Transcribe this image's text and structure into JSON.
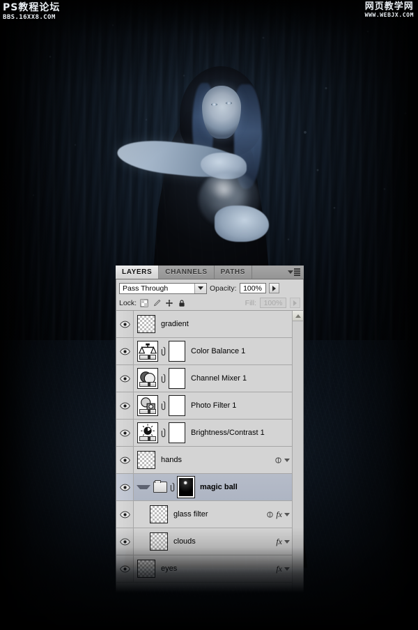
{
  "watermarks": {
    "top_left": {
      "title": "PS教程论坛",
      "url": "BBS.16XX8.COM"
    },
    "top_right": {
      "title": "网页教学网",
      "url": "WWW.WEBJX.COM"
    }
  },
  "artwork": {
    "description": "Dark forest scene with hooded woman holding a glowing smoky magic ball",
    "colors": {
      "background": "#05070b",
      "highlight": "#b9c9da",
      "hair": "#4a6a9a"
    }
  },
  "panel": {
    "title": "Layers panel",
    "tabs": [
      {
        "label": "LAYERS",
        "active": true
      },
      {
        "label": "CHANNELS",
        "active": false
      },
      {
        "label": "PATHS",
        "active": false
      }
    ],
    "menu_icon": "panel-menu-icon",
    "blend_mode": {
      "value": "Pass Through",
      "icon": "chevron-down-icon"
    },
    "opacity": {
      "label": "Opacity:",
      "value": "100%",
      "stepper_icon": "chevron-right-icon"
    },
    "lock": {
      "label": "Lock:",
      "icons": [
        "lock-transparent-pixels-icon",
        "lock-image-pixels-icon",
        "lock-position-icon",
        "lock-all-icon"
      ]
    },
    "fill": {
      "label": "Fill:",
      "value": "100%",
      "disabled": true,
      "stepper_icon": "chevron-right-icon"
    },
    "scrollbar": {
      "up_icon": "scroll-up-icon"
    },
    "layers": [
      {
        "name": "gradient",
        "visible": true,
        "selected": false,
        "indent": false,
        "thumb": "checker",
        "mask": null,
        "link": false,
        "fx": false,
        "style_dot": false,
        "expand": null,
        "folder": false
      },
      {
        "name": "Color Balance 1",
        "visible": true,
        "selected": false,
        "indent": false,
        "thumb": "adj-color-balance",
        "mask": "white",
        "link": true,
        "fx": false,
        "style_dot": false,
        "expand": null,
        "folder": false
      },
      {
        "name": "Channel Mixer 1",
        "visible": true,
        "selected": false,
        "indent": false,
        "thumb": "adj-channel-mixer",
        "mask": "white",
        "link": true,
        "fx": false,
        "style_dot": false,
        "expand": null,
        "folder": false
      },
      {
        "name": "Photo Filter 1",
        "visible": true,
        "selected": false,
        "indent": false,
        "thumb": "adj-photo-filter",
        "mask": "white",
        "link": true,
        "fx": false,
        "style_dot": false,
        "expand": null,
        "folder": false
      },
      {
        "name": "Brightness/Contrast 1",
        "visible": true,
        "selected": false,
        "indent": false,
        "thumb": "adj-brightness",
        "mask": "white",
        "link": true,
        "fx": false,
        "style_dot": false,
        "expand": null,
        "folder": false
      },
      {
        "name": "hands",
        "visible": true,
        "selected": false,
        "indent": false,
        "thumb": "checker",
        "mask": null,
        "link": false,
        "fx": false,
        "style_dot": true,
        "expand": null,
        "folder": false
      },
      {
        "name": "magic ball",
        "visible": true,
        "selected": true,
        "indent": false,
        "thumb": null,
        "mask": "black",
        "link": true,
        "fx": false,
        "style_dot": false,
        "expand": "open",
        "folder": true
      },
      {
        "name": "glass filter",
        "visible": true,
        "selected": false,
        "indent": true,
        "thumb": "checker",
        "mask": null,
        "link": false,
        "fx": true,
        "style_dot": true,
        "expand": null,
        "folder": false
      },
      {
        "name": "clouds",
        "visible": true,
        "selected": false,
        "indent": true,
        "thumb": "checker",
        "mask": null,
        "link": false,
        "fx": true,
        "style_dot": false,
        "expand": null,
        "folder": false
      },
      {
        "name": "eyes",
        "visible": true,
        "selected": false,
        "indent": false,
        "thumb": "checker",
        "mask": null,
        "link": false,
        "fx": true,
        "style_dot": false,
        "expand": null,
        "folder": false
      }
    ]
  }
}
